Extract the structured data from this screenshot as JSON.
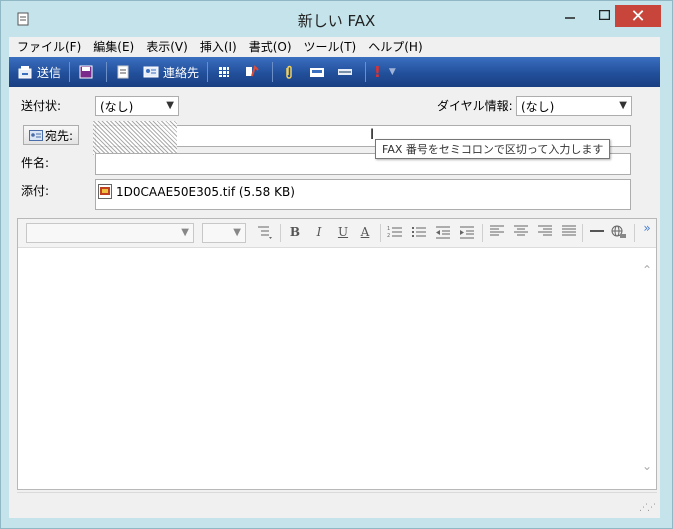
{
  "window": {
    "title": "新しい FAX",
    "close_symbol": "✕"
  },
  "menu": [
    {
      "label": "ファイル(F)"
    },
    {
      "label": "編集(E)"
    },
    {
      "label": "表示(V)"
    },
    {
      "label": "挿入(I)"
    },
    {
      "label": "書式(O)"
    },
    {
      "label": "ツール(T)"
    },
    {
      "label": "ヘルプ(H)"
    }
  ],
  "toolbar": {
    "send_label": "送信",
    "contacts_label": "連絡先",
    "priority_symbol": "!"
  },
  "form": {
    "cover_page_label": "送付状:",
    "cover_page_value": "(なし)",
    "dialing_rule_label": "ダイヤル情報:",
    "dialing_rule_value": "(なし)",
    "to_button_label": "宛先:",
    "subject_label": "件名:",
    "attachment_label": "添付:",
    "attachment_file": "1D0CAAE50E305.tif (5.58 KB)",
    "tooltip": "FAX 番号をセミコロンで区切って入力します"
  },
  "format_toolbar": {
    "bold": "B",
    "italic": "I",
    "underline": "U",
    "font_color": "A",
    "more": "»"
  },
  "colors": {
    "toolbar_blue": "#224f9a",
    "close_red": "#c7453b",
    "window_frame": "#c4e3ea"
  }
}
